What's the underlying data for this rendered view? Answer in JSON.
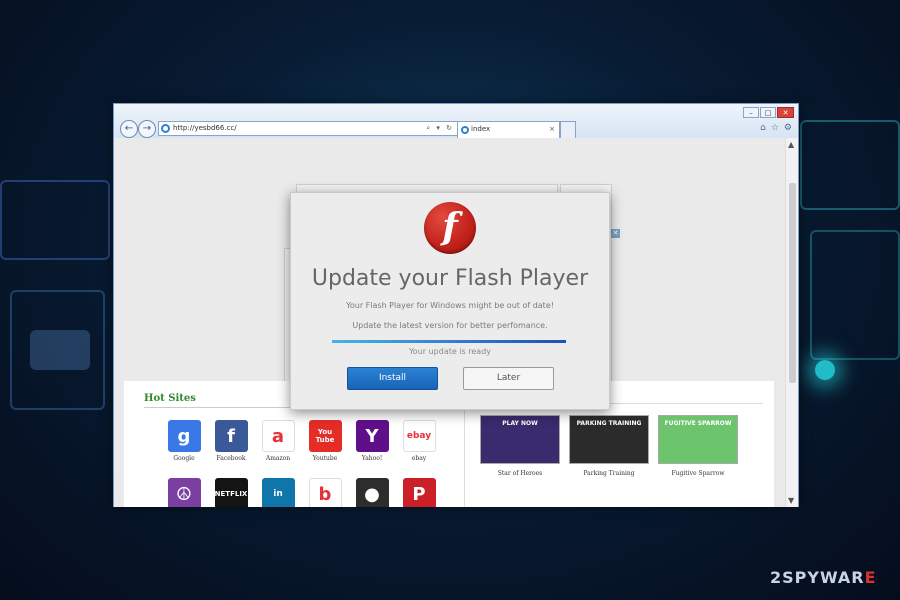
{
  "browser": {
    "address_url": "http://yesbd66.cc/",
    "address_tools": "⌕ ▾ ↻",
    "tab_label": "index",
    "tab_close": "×",
    "window_controls": [
      "–",
      "□",
      "✕"
    ],
    "toolbar_icons": [
      "⌂",
      "☆",
      "⚙"
    ]
  },
  "hot_sites": {
    "title": "Hot Sites",
    "sites": [
      {
        "label": "Google",
        "glyph": "g",
        "color": "#3b78e7"
      },
      {
        "label": "Facebook",
        "glyph": "f",
        "color": "#3b5998"
      },
      {
        "label": "Amazon",
        "glyph": "a",
        "color": "#ffffff"
      },
      {
        "label": "Youtube",
        "glyph": "You Tube",
        "color": "#e52d27"
      },
      {
        "label": "Yahoo!",
        "glyph": "Y",
        "color": "#5f0f8a"
      },
      {
        "label": "ebay",
        "glyph": "ebay",
        "color": "#ffffff"
      },
      {
        "label": "",
        "glyph": "☮",
        "color": "#7a3fa0"
      },
      {
        "label": "",
        "glyph": "NETFLIX",
        "color": "#141414"
      },
      {
        "label": "",
        "glyph": "in",
        "color": "#0e76a8"
      },
      {
        "label": "",
        "glyph": "b",
        "color": "#ffffff"
      },
      {
        "label": "",
        "glyph": "●",
        "color": "#2d2d2d"
      },
      {
        "label": "",
        "glyph": "P",
        "color": "#cb2027"
      }
    ]
  },
  "games": {
    "items": [
      {
        "label": "Star of Heroes",
        "badge": "PLAY NOW",
        "color": "#3a2a6e"
      },
      {
        "label": "Parking Training",
        "badge": "PARKING TRAINING",
        "color": "#2b2b2b"
      },
      {
        "label": "Fugitive Sparrow",
        "badge": "FUGITIVE SPARROW",
        "color": "#6cc46c"
      }
    ]
  },
  "dialog": {
    "logo_glyph": "f",
    "title": "Update your Flash Player",
    "line1": "Your Flash Player for Windows might be out of date!",
    "line2": "Update the latest version for better perfomance.",
    "progress": 1.0,
    "status": "Your update is ready",
    "install_label": "Install",
    "later_label": "Later"
  },
  "watermark": {
    "digit": "2",
    "text": "SPYWAR",
    "accent": "E"
  }
}
